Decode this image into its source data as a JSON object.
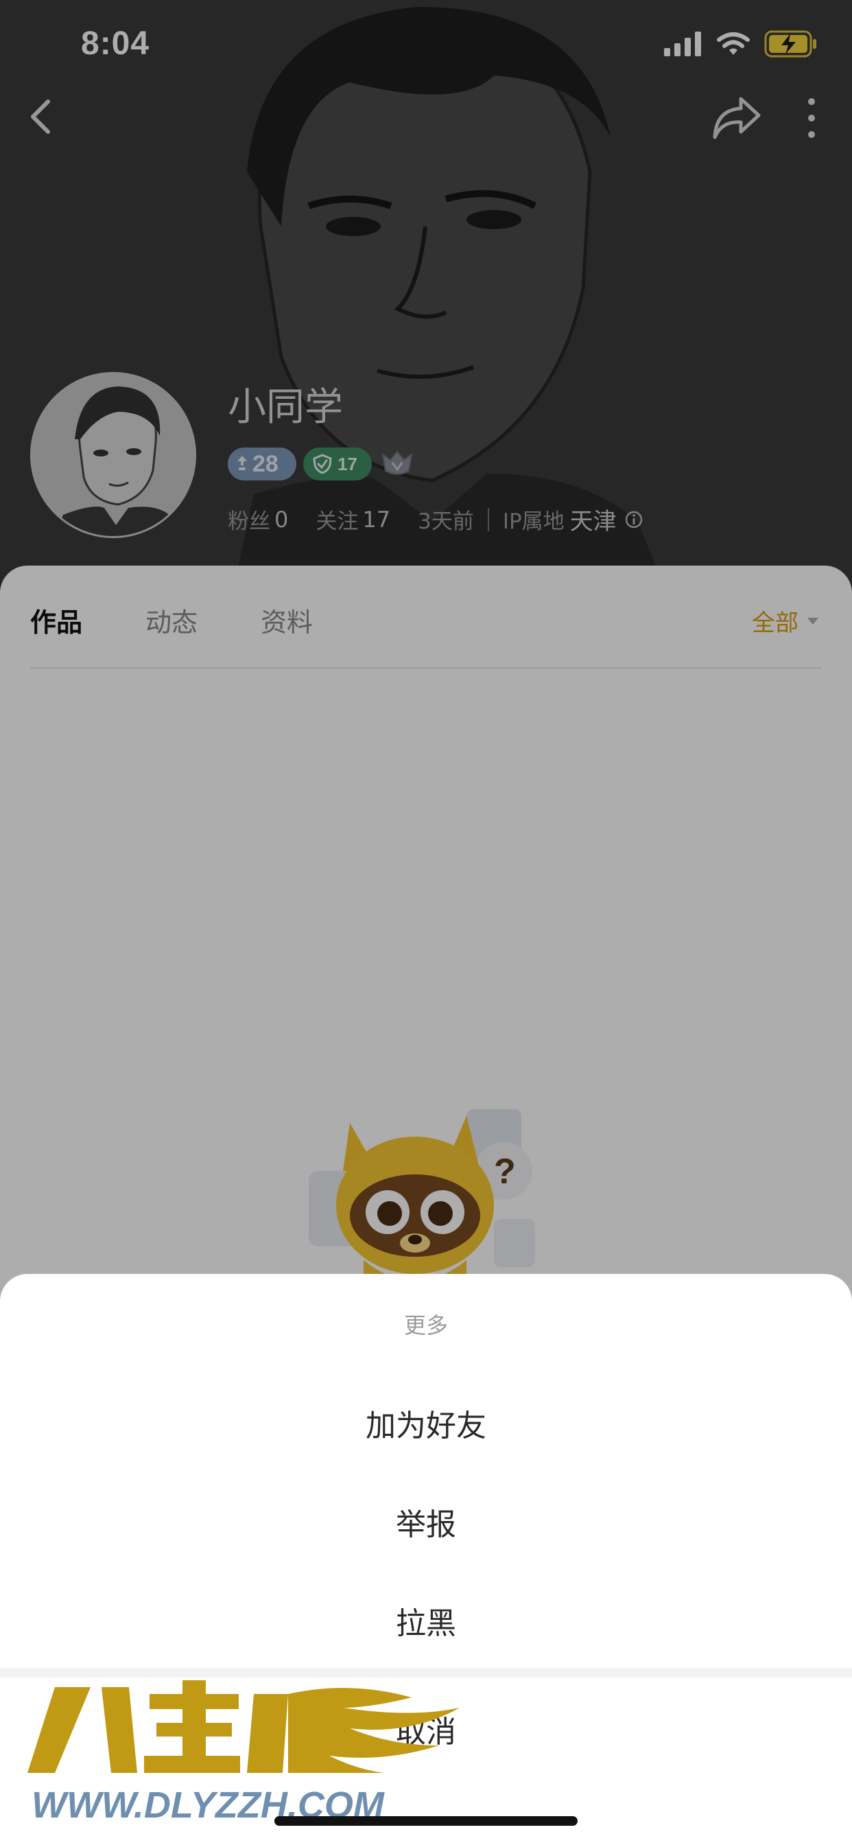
{
  "status_bar": {
    "time": "8:04"
  },
  "profile": {
    "username": "小同学",
    "level_badge": "28",
    "green_badge": "17",
    "stats": {
      "fans_label": "粉丝",
      "fans_count": "0",
      "following_label": "关注",
      "following_count": "17",
      "last_active": "3天前",
      "ip_label": "IP属地",
      "ip_location": "天津"
    }
  },
  "tabs": [
    {
      "label": "作品",
      "active": true
    },
    {
      "label": "动态",
      "active": false
    },
    {
      "label": "资料",
      "active": false
    }
  ],
  "filter": {
    "label": "全部"
  },
  "action_sheet": {
    "title": "更多",
    "items": [
      "加为好友",
      "举报",
      "拉黑"
    ],
    "cancel": "取消"
  },
  "watermark": {
    "text": "WWW.DLYZZH.COM"
  },
  "colors": {
    "header_bg": "#3a3a3a",
    "accent_gold": "#d79d10",
    "level_badge": "#7e98b7",
    "green_badge": "#3f8d63"
  }
}
